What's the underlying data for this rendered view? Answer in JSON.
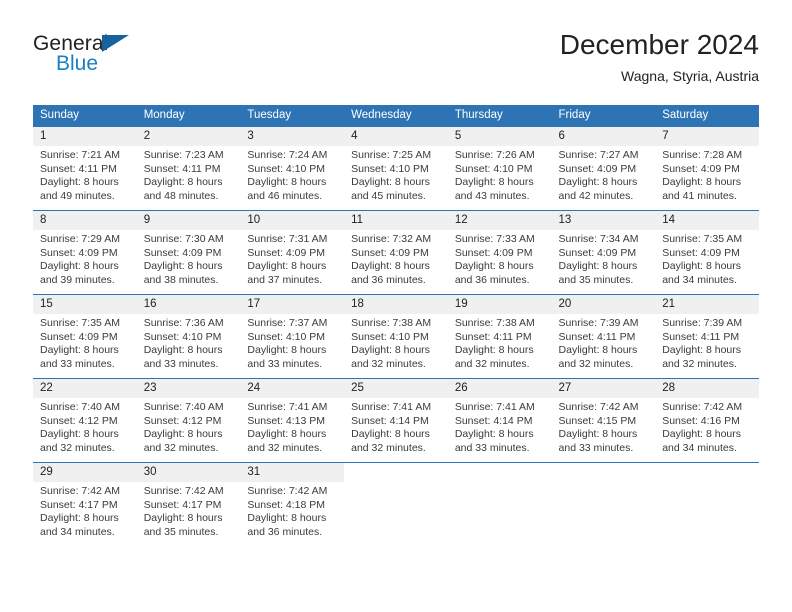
{
  "brand": {
    "line1": "General",
    "line2": "Blue",
    "triangle_color": "#17619e",
    "blue_color": "#1b7fc4"
  },
  "header": {
    "title": "December 2024",
    "location": "Wagna, Styria, Austria"
  },
  "theme": {
    "header_blue": "#2e74b5",
    "daynum_bg": "#f0f0f0",
    "text": "#222222"
  },
  "weekdays": [
    "Sunday",
    "Monday",
    "Tuesday",
    "Wednesday",
    "Thursday",
    "Friday",
    "Saturday"
  ],
  "weeks": [
    [
      {
        "day": "1",
        "sunrise": "Sunrise: 7:21 AM",
        "sunset": "Sunset: 4:11 PM",
        "daylight1": "Daylight: 8 hours",
        "daylight2": "and 49 minutes."
      },
      {
        "day": "2",
        "sunrise": "Sunrise: 7:23 AM",
        "sunset": "Sunset: 4:11 PM",
        "daylight1": "Daylight: 8 hours",
        "daylight2": "and 48 minutes."
      },
      {
        "day": "3",
        "sunrise": "Sunrise: 7:24 AM",
        "sunset": "Sunset: 4:10 PM",
        "daylight1": "Daylight: 8 hours",
        "daylight2": "and 46 minutes."
      },
      {
        "day": "4",
        "sunrise": "Sunrise: 7:25 AM",
        "sunset": "Sunset: 4:10 PM",
        "daylight1": "Daylight: 8 hours",
        "daylight2": "and 45 minutes."
      },
      {
        "day": "5",
        "sunrise": "Sunrise: 7:26 AM",
        "sunset": "Sunset: 4:10 PM",
        "daylight1": "Daylight: 8 hours",
        "daylight2": "and 43 minutes."
      },
      {
        "day": "6",
        "sunrise": "Sunrise: 7:27 AM",
        "sunset": "Sunset: 4:09 PM",
        "daylight1": "Daylight: 8 hours",
        "daylight2": "and 42 minutes."
      },
      {
        "day": "7",
        "sunrise": "Sunrise: 7:28 AM",
        "sunset": "Sunset: 4:09 PM",
        "daylight1": "Daylight: 8 hours",
        "daylight2": "and 41 minutes."
      }
    ],
    [
      {
        "day": "8",
        "sunrise": "Sunrise: 7:29 AM",
        "sunset": "Sunset: 4:09 PM",
        "daylight1": "Daylight: 8 hours",
        "daylight2": "and 39 minutes."
      },
      {
        "day": "9",
        "sunrise": "Sunrise: 7:30 AM",
        "sunset": "Sunset: 4:09 PM",
        "daylight1": "Daylight: 8 hours",
        "daylight2": "and 38 minutes."
      },
      {
        "day": "10",
        "sunrise": "Sunrise: 7:31 AM",
        "sunset": "Sunset: 4:09 PM",
        "daylight1": "Daylight: 8 hours",
        "daylight2": "and 37 minutes."
      },
      {
        "day": "11",
        "sunrise": "Sunrise: 7:32 AM",
        "sunset": "Sunset: 4:09 PM",
        "daylight1": "Daylight: 8 hours",
        "daylight2": "and 36 minutes."
      },
      {
        "day": "12",
        "sunrise": "Sunrise: 7:33 AM",
        "sunset": "Sunset: 4:09 PM",
        "daylight1": "Daylight: 8 hours",
        "daylight2": "and 36 minutes."
      },
      {
        "day": "13",
        "sunrise": "Sunrise: 7:34 AM",
        "sunset": "Sunset: 4:09 PM",
        "daylight1": "Daylight: 8 hours",
        "daylight2": "and 35 minutes."
      },
      {
        "day": "14",
        "sunrise": "Sunrise: 7:35 AM",
        "sunset": "Sunset: 4:09 PM",
        "daylight1": "Daylight: 8 hours",
        "daylight2": "and 34 minutes."
      }
    ],
    [
      {
        "day": "15",
        "sunrise": "Sunrise: 7:35 AM",
        "sunset": "Sunset: 4:09 PM",
        "daylight1": "Daylight: 8 hours",
        "daylight2": "and 33 minutes."
      },
      {
        "day": "16",
        "sunrise": "Sunrise: 7:36 AM",
        "sunset": "Sunset: 4:10 PM",
        "daylight1": "Daylight: 8 hours",
        "daylight2": "and 33 minutes."
      },
      {
        "day": "17",
        "sunrise": "Sunrise: 7:37 AM",
        "sunset": "Sunset: 4:10 PM",
        "daylight1": "Daylight: 8 hours",
        "daylight2": "and 33 minutes."
      },
      {
        "day": "18",
        "sunrise": "Sunrise: 7:38 AM",
        "sunset": "Sunset: 4:10 PM",
        "daylight1": "Daylight: 8 hours",
        "daylight2": "and 32 minutes."
      },
      {
        "day": "19",
        "sunrise": "Sunrise: 7:38 AM",
        "sunset": "Sunset: 4:11 PM",
        "daylight1": "Daylight: 8 hours",
        "daylight2": "and 32 minutes."
      },
      {
        "day": "20",
        "sunrise": "Sunrise: 7:39 AM",
        "sunset": "Sunset: 4:11 PM",
        "daylight1": "Daylight: 8 hours",
        "daylight2": "and 32 minutes."
      },
      {
        "day": "21",
        "sunrise": "Sunrise: 7:39 AM",
        "sunset": "Sunset: 4:11 PM",
        "daylight1": "Daylight: 8 hours",
        "daylight2": "and 32 minutes."
      }
    ],
    [
      {
        "day": "22",
        "sunrise": "Sunrise: 7:40 AM",
        "sunset": "Sunset: 4:12 PM",
        "daylight1": "Daylight: 8 hours",
        "daylight2": "and 32 minutes."
      },
      {
        "day": "23",
        "sunrise": "Sunrise: 7:40 AM",
        "sunset": "Sunset: 4:12 PM",
        "daylight1": "Daylight: 8 hours",
        "daylight2": "and 32 minutes."
      },
      {
        "day": "24",
        "sunrise": "Sunrise: 7:41 AM",
        "sunset": "Sunset: 4:13 PM",
        "daylight1": "Daylight: 8 hours",
        "daylight2": "and 32 minutes."
      },
      {
        "day": "25",
        "sunrise": "Sunrise: 7:41 AM",
        "sunset": "Sunset: 4:14 PM",
        "daylight1": "Daylight: 8 hours",
        "daylight2": "and 32 minutes."
      },
      {
        "day": "26",
        "sunrise": "Sunrise: 7:41 AM",
        "sunset": "Sunset: 4:14 PM",
        "daylight1": "Daylight: 8 hours",
        "daylight2": "and 33 minutes."
      },
      {
        "day": "27",
        "sunrise": "Sunrise: 7:42 AM",
        "sunset": "Sunset: 4:15 PM",
        "daylight1": "Daylight: 8 hours",
        "daylight2": "and 33 minutes."
      },
      {
        "day": "28",
        "sunrise": "Sunrise: 7:42 AM",
        "sunset": "Sunset: 4:16 PM",
        "daylight1": "Daylight: 8 hours",
        "daylight2": "and 34 minutes."
      }
    ],
    [
      {
        "day": "29",
        "sunrise": "Sunrise: 7:42 AM",
        "sunset": "Sunset: 4:17 PM",
        "daylight1": "Daylight: 8 hours",
        "daylight2": "and 34 minutes."
      },
      {
        "day": "30",
        "sunrise": "Sunrise: 7:42 AM",
        "sunset": "Sunset: 4:17 PM",
        "daylight1": "Daylight: 8 hours",
        "daylight2": "and 35 minutes."
      },
      {
        "day": "31",
        "sunrise": "Sunrise: 7:42 AM",
        "sunset": "Sunset: 4:18 PM",
        "daylight1": "Daylight: 8 hours",
        "daylight2": "and 36 minutes."
      },
      {
        "day": "",
        "sunrise": "",
        "sunset": "",
        "daylight1": "",
        "daylight2": ""
      },
      {
        "day": "",
        "sunrise": "",
        "sunset": "",
        "daylight1": "",
        "daylight2": ""
      },
      {
        "day": "",
        "sunrise": "",
        "sunset": "",
        "daylight1": "",
        "daylight2": ""
      },
      {
        "day": "",
        "sunrise": "",
        "sunset": "",
        "daylight1": "",
        "daylight2": ""
      }
    ]
  ]
}
